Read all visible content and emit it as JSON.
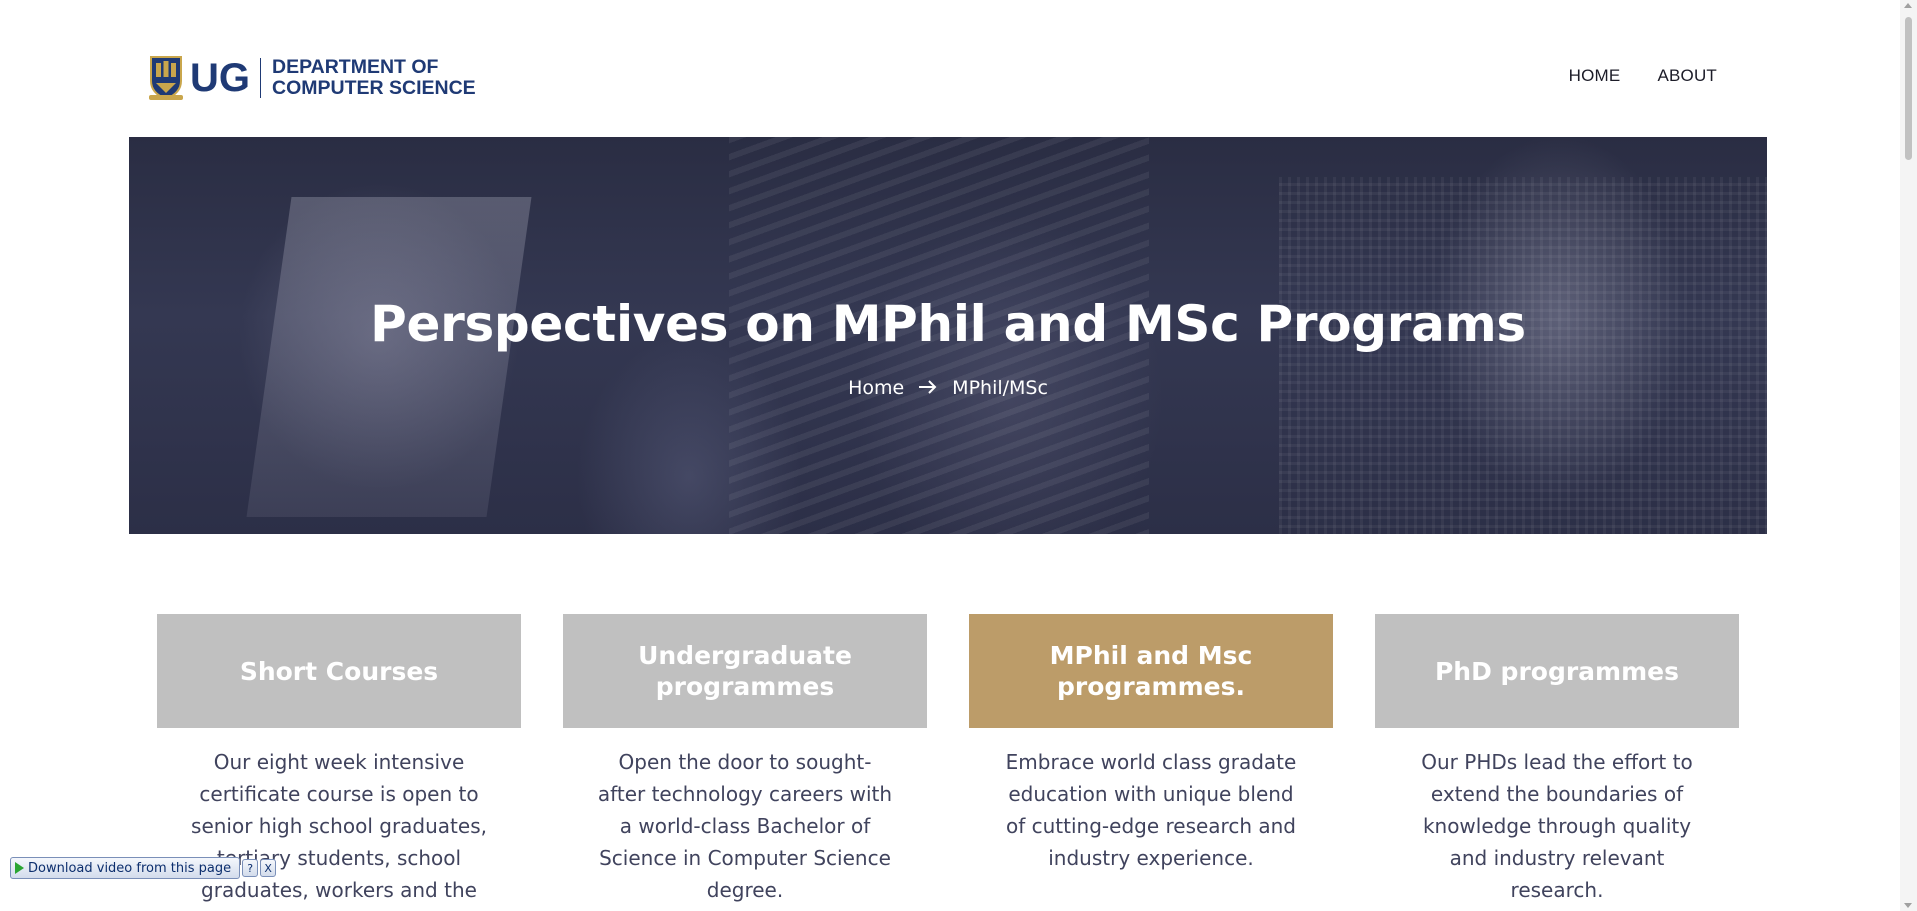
{
  "header": {
    "logo": {
      "abbr": "UG",
      "dept_line1": "DEPARTMENT OF",
      "dept_line2": "COMPUTER SCIENCE",
      "crest_icon": "university-crest-icon"
    },
    "nav": [
      {
        "label": "HOME"
      },
      {
        "label": "ABOUT"
      }
    ]
  },
  "hero": {
    "title": "Perspectives on MPhil and MSc Programs",
    "breadcrumb": {
      "home": "Home",
      "separator_icon": "arrow-right-icon",
      "current": "MPhil/MSc"
    }
  },
  "cards": [
    {
      "title": "Short Courses",
      "body": "Our eight week intensive certificate course is open to senior high school graduates, tertiary students, school graduates, workers and the",
      "active": false
    },
    {
      "title": "Undergraduate programmes",
      "body": "Open the door to sought-after technology careers with a world-class Bachelor of Science in Computer Science degree.",
      "active": false
    },
    {
      "title": "MPhil and Msc programmes.",
      "body": "Embrace world class gradate education with unique blend of cutting-edge research and industry experience.",
      "active": true
    },
    {
      "title": "PhD programmes",
      "body": "Our PHDs lead the effort to extend the boundaries of knowledge through quality and industry relevant research.",
      "active": false
    }
  ],
  "download_bar": {
    "label": "Download video from this page",
    "help": "?",
    "close": "X"
  },
  "colors": {
    "brand_blue": "#1f3a75",
    "active_card": "#bc9c69",
    "inactive_card": "#c0c0c0"
  }
}
